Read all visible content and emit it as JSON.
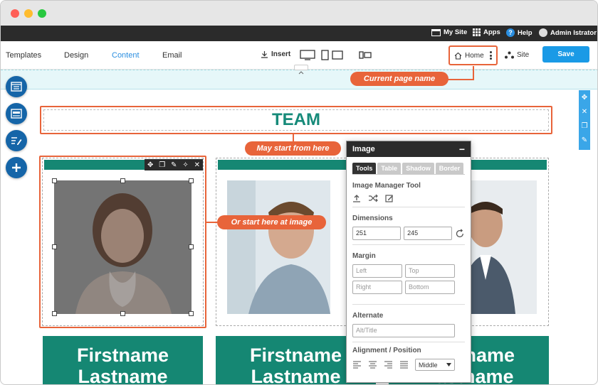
{
  "topbar": {
    "my_site": "My Site",
    "apps": "Apps",
    "help": "Help",
    "user": "Admin Istrator"
  },
  "toolbar": {
    "tabs": [
      "Templates",
      "Design",
      "Content",
      "Email"
    ],
    "insert": "Insert",
    "home": "Home",
    "site": "Site",
    "save": "Save"
  },
  "page": {
    "title": "TEAM",
    "cards": [
      {
        "first": "Firstname",
        "last": "Lastname"
      },
      {
        "first": "Firstname",
        "last": "Lastname"
      },
      {
        "first": "Firstname",
        "last": "Lastname"
      }
    ]
  },
  "callouts": {
    "page_name": "Current page name",
    "start_here": "May start from here",
    "start_image": "Or start here at image"
  },
  "panel": {
    "title": "Image",
    "tabs": [
      "Tools",
      "Table",
      "Shadow",
      "Border"
    ],
    "image_manager": "Image Manager Tool",
    "dimensions": "Dimensions",
    "width": "251",
    "height": "245",
    "margin": "Margin",
    "margin_left": "Left",
    "margin_top": "Top",
    "margin_right": "Right",
    "margin_bottom": "Bottom",
    "alternate": "Alternate",
    "alt_placeholder": "Alt/Title",
    "alignment": "Alignment / Position",
    "position": "Middle"
  },
  "colors": {
    "accent": "#e8643a",
    "teal": "#158773",
    "blue": "#1a9ae6",
    "dark": "#2b2b2b"
  }
}
